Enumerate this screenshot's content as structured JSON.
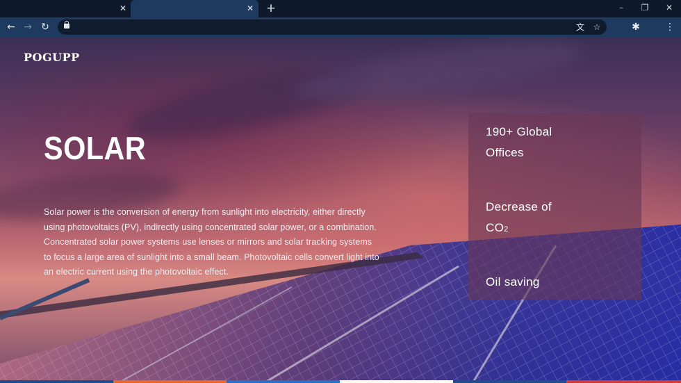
{
  "browser": {
    "tabs": [
      {
        "close_icon": "close-icon"
      },
      {
        "close_icon": "close-icon"
      }
    ],
    "new_tab_glyph": "+",
    "window_controls": {
      "minimize": "–",
      "restore": "❐",
      "close": "✕"
    },
    "nav": {
      "back": "←",
      "forward": "→",
      "reload": "↻"
    },
    "omnibox": {
      "url": "",
      "translate": "文",
      "star": "☆"
    },
    "extensions": "✱",
    "menu": "⋮"
  },
  "page": {
    "logo": "POGUPP",
    "title": "SOLAR",
    "description_lines": [
      "Solar power is the conversion of energy from sunlight into electricity, either directly",
      "using photovoltaics (PV), indirectly using concentrated solar power, or a combination.",
      "Concentrated solar power systems use lenses or mirrors and solar tracking systems",
      "to focus a large area of sunlight into a small beam. Photovoltaic cells convert light into",
      " an electric current using the photovoltaic effect."
    ],
    "stats": {
      "global_offices_line1": "190+ Global",
      "global_offices_line2": "Offices",
      "co2_line1": "Decrease of",
      "co2_line2": "CO",
      "co2_sub": "2",
      "oil": "Oil saving"
    }
  },
  "colors": {
    "chrome_dark": "#0e1a2b",
    "chrome_active": "#1f3a5f",
    "stat_box": "#69375599",
    "strip": [
      "#1f4e8c",
      "#e8672b",
      "#2b6fc7",
      "#ffffff",
      "#1f4e8c",
      "#d23a3a"
    ]
  }
}
